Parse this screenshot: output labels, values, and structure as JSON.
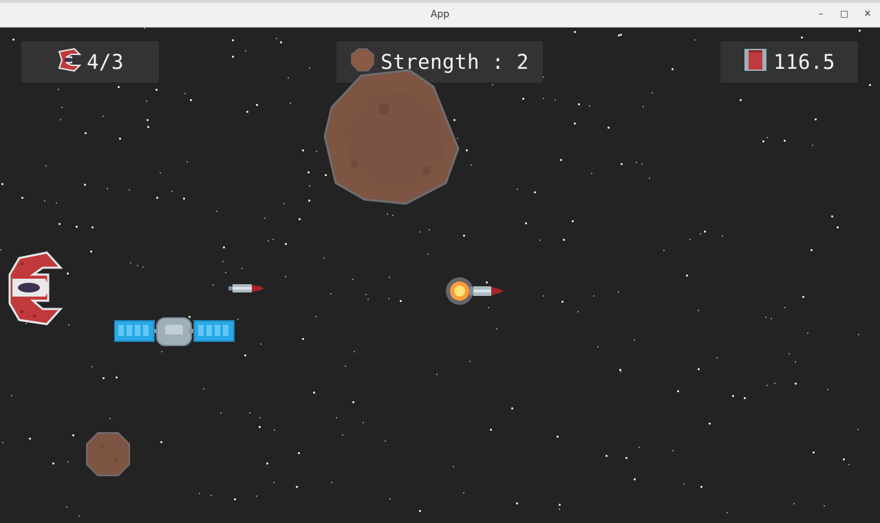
{
  "window": {
    "title": "App"
  },
  "hud": {
    "lives": "4/3",
    "strength_label": "Strength : 2",
    "fuel": "116.5"
  },
  "colors": {
    "background": "#232323",
    "hud_panel": "#333333",
    "ship_red": "#c0393b",
    "asteroid_brown": "#8a5a44",
    "solar_panel_blue": "#29a8e8",
    "missile_flame": "#ff9a3a"
  },
  "icons": {
    "lives": "spaceship-icon",
    "strength": "asteroid-icon",
    "fuel": "fuel-tank-icon"
  }
}
